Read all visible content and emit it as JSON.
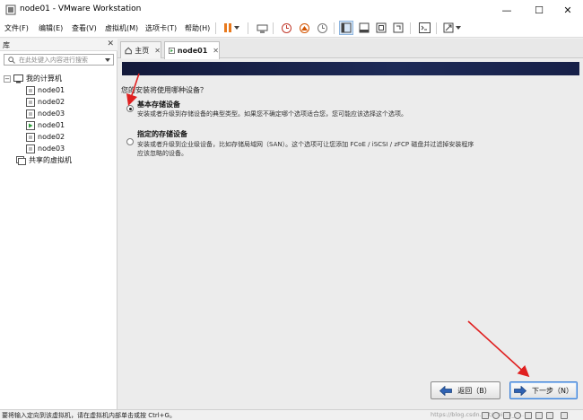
{
  "window": {
    "title": "node01 - VMware Workstation",
    "controls": {
      "minimize": "—",
      "maximize": "☐",
      "close": "✕"
    }
  },
  "menu": [
    "文件(F)",
    "编辑(E)",
    "查看(V)",
    "虚拟机(M)",
    "选项卡(T)",
    "帮助(H)"
  ],
  "library": {
    "title": "库",
    "close": "✕",
    "search_placeholder": "在此处键入内容进行搜索",
    "tree": {
      "root": "我的计算机",
      "vms": [
        "node01",
        "node02",
        "node03",
        "node01",
        "node02",
        "node03"
      ],
      "shared": "共享的虚拟机"
    }
  },
  "tabs": [
    {
      "label": "主页",
      "close": "✕"
    },
    {
      "label": "node01",
      "close": "✕"
    }
  ],
  "installer": {
    "question": "您的安装将使用哪种设备？",
    "options": [
      {
        "title": "基本存储设备",
        "desc": "安装或者升级到存储设备的典型类型。如果您不确定哪个选项适合您，您可能应该选择这个选项。",
        "selected": true
      },
      {
        "title": "指定的存储设备",
        "desc1": "安装或者升级到企业级设备，比如存储局域网（SAN）。这个选项可让您添加 FCoE / iSCSI / zFCP 磁盘并过滤掉安装程序",
        "desc2": "应该忽略的设备。",
        "selected": false
      }
    ],
    "back_label": "返回（B）",
    "next_label": "下一步（N）"
  },
  "status": {
    "message": "要将输入定向到该虚拟机，请在虚拟机内部单击或按 Ctrl+G。",
    "watermark": "https://blog.csdn.net/weixin_4..."
  },
  "colors": {
    "banner": "#172048",
    "annotation": "#e02020",
    "accent": "#3c7fd6"
  }
}
